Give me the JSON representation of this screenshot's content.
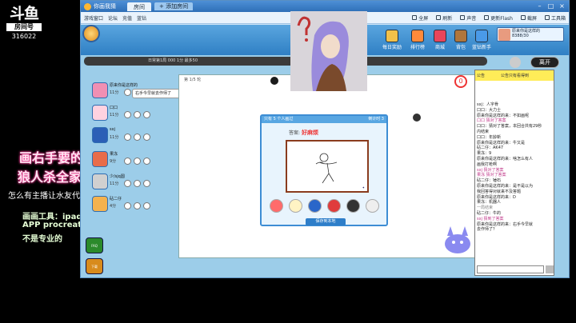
{
  "stream": {
    "platform_logo": "斗鱼",
    "room_label": "房间号",
    "room_number": "316022"
  },
  "overlay": {
    "line1": "画右手要的",
    "line2": "狼人杀全家桶",
    "line3": "怎么有主播让水友代描啊",
    "tools_title": "画画工具：ipad 手",
    "tools_app": "APP procreate",
    "tools_note": "不是专业的"
  },
  "window": {
    "app_name": "你画我猜",
    "tab_label": "房间",
    "tab2_label": "+ 添加房间",
    "toolbar_left": [
      "游戏窗口",
      "论坛",
      "充值",
      "蓝钻"
    ],
    "toolbar_right": [
      "全屏",
      "刷新",
      "声音",
      "更新Flash",
      "截屏",
      "工具箱"
    ]
  },
  "banner": {
    "nav": [
      "每日奖励",
      "排行榜",
      "商城",
      "背包",
      "蓝钻新手"
    ],
    "profile_line1": "原来你是这样的",
    "profile_line2": "8388/30"
  },
  "room": {
    "info": "日常第1局 000 1分  最多50",
    "exit_button": "离开"
  },
  "players": [
    {
      "name": "原来你是这样的",
      "score": "11分"
    },
    {
      "name": "口口",
      "score": "11分"
    },
    {
      "name": "sxj",
      "score": "11分"
    },
    {
      "name": "果冻",
      "score": "9分"
    },
    {
      "name": "少/sjq圆",
      "score": "11分"
    },
    {
      "name": "砧二仔",
      "score": "4分"
    }
  ],
  "speech_bubble": "右手今早就去作师了",
  "board": {
    "round": "第 1/5 轮",
    "countdown": "0"
  },
  "popup": {
    "header_left": "只有 5 个人画过",
    "header_right": "倒计时 3",
    "answer_label": "答案:",
    "answer": "好麻烦",
    "save_button": "保存到本地"
  },
  "chat": {
    "header_left": "公告",
    "header_title": "公告只有看得到",
    "lines": [
      "sxj：人字骨",
      "口口：大力士",
      "原来你是这样的来：不如画呢",
      "口口 猜对了答案",
      "口口：猜对了答案，本回合共有29秒",
      "内结束",
      "口口：年龄新",
      "原来你是这样的来：牛又是",
      "砧二仔：AK47",
      "果冻：9",
      "原来你是这样的来：啥怎么有人",
      "画我打枪啊",
      "sxj 猜对了答案",
      "果冻 猜对了答案",
      "砧二仔：锤石",
      "原来你是这样的来：是不是以为",
      "我回答得对就来不及答题",
      "原来你是这样的来：D",
      "果冻：机器人",
      "一局结束",
      "砧二仔：牛的",
      "sxj 猜到了答案",
      "原来你是这样的来：右手今早就",
      "去作师了？"
    ]
  },
  "left_icons": [
    "FAQ",
    "下载"
  ],
  "colors": {
    "accent": "#3d8dd4",
    "overlay_pink": "#ff3f9b",
    "countdown": "#e33333",
    "chat_header": "#ffec58"
  }
}
